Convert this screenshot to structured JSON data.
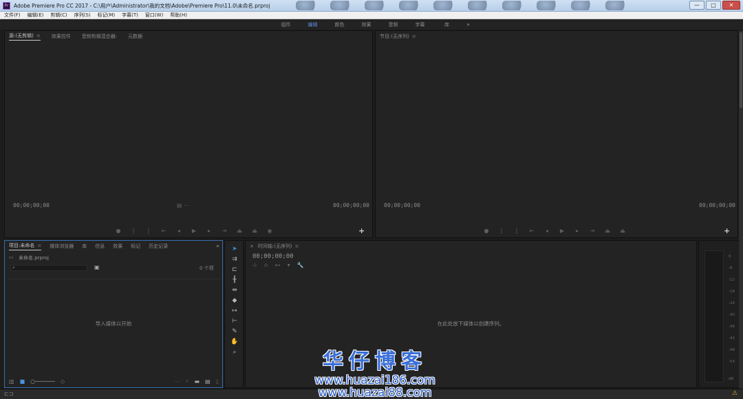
{
  "window": {
    "title": "Adobe Premiere Pro CC 2017 - C:\\用户\\Administrator\\我的文档\\Adobe\\Premiere Pro\\11.0\\未命名.prproj",
    "minimize": "—",
    "maximize": "□",
    "close": "✕"
  },
  "menubar": {
    "items": [
      "文件(F)",
      "编辑(E)",
      "剪辑(C)",
      "序列(S)",
      "标记(M)",
      "字幕(T)",
      "窗口(W)",
      "帮助(H)"
    ]
  },
  "workspaces": {
    "tabs": [
      "组件",
      "编辑",
      "颜色",
      "效果",
      "音频",
      "字幕",
      "库"
    ],
    "active_index": 1,
    "more": "»"
  },
  "source_monitor": {
    "tabs": [
      "源:(无剪辑)",
      "效果控件",
      "音频剪辑混合器:",
      "元数据"
    ],
    "tab_menu": "≡",
    "timecode_left": "00;00;00;00",
    "timecode_right": "00;00;00;00",
    "add": "+"
  },
  "program_monitor": {
    "tab": "节目:(无序列)",
    "tab_menu": "≡",
    "timecode_left": "00;00;00;00",
    "timecode_right": "00;00;00;00",
    "add": "+"
  },
  "project": {
    "tabs": [
      "项目:未命名",
      "媒体浏览器",
      "库",
      "信息",
      "效果",
      "标记",
      "历史记录"
    ],
    "tab_menu": "≡",
    "more": "»",
    "file_name": "未命名.prproj",
    "item_count": "0 个项",
    "empty_text": "导入媒体以开始"
  },
  "timeline": {
    "tab": "时间轴:(无序列)",
    "tab_menu": "≡",
    "close": "×",
    "timecode": "00;00;00;00",
    "empty_text": "在此处放下媒体以创建序列。"
  },
  "audio_meter": {
    "labels": [
      "0",
      "-6",
      "-12",
      "-18",
      "-24",
      "-30",
      "-36",
      "-42",
      "-48",
      "-54",
      "dB"
    ]
  },
  "watermark": {
    "title": "华仔博客",
    "url1": "www.huazai186.com",
    "url2": "www.huazai88.com"
  },
  "colors": {
    "accent": "#5a8fd6",
    "panel_bg": "#232323",
    "app_bg": "#1d1d1d",
    "tool_active": "#3e8bdb",
    "watermark": "#3a6fd8"
  }
}
